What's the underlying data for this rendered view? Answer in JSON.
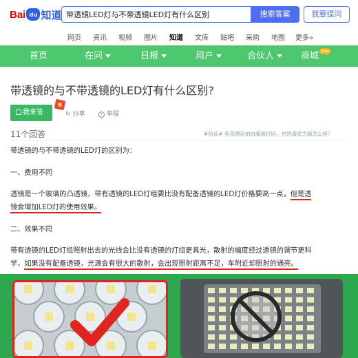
{
  "header": {
    "logo_bai": "Bai",
    "logo_du": "du",
    "logo_zhidao": "知道",
    "search_value": "带透镜LED灯与不带透镜LED灯有什么区别",
    "search_button": "搜索答案",
    "ask_button": "我要提问"
  },
  "channels": [
    "网页",
    "资讯",
    "视频",
    "图片",
    "知道",
    "文库",
    "贴吧",
    "采购",
    "地图",
    "更多»"
  ],
  "active_channel": "知道",
  "green_nav": {
    "items": [
      "首页",
      "在问",
      "日报",
      "用户",
      "合伙人",
      "商城"
    ],
    "new_badge": "New",
    "bg_color": "#4ec86f"
  },
  "question": {
    "title": "带透镜的与不带透镜的LED灯有什么区别?",
    "answer_button": "我来答",
    "share": "分享",
    "report": "举报",
    "answer_count": "11个回答",
    "topic_tag": "#热议#",
    "topic_text": "李现晒自拍给腹肌打码，也的演绎之路怎么样?"
  },
  "answer": {
    "intro": "带透镜的与不带透镜的LED灯的区别为：",
    "h1": "一、费用不同",
    "p1_line1_a": "透镜是一个玻璃的凸透镜，带有透镜的LED灯组要比没有配备透镜的LED灯价格要高一点，",
    "p1_line1_b": "但是透",
    "p1_line2": "镜会增加LED灯的使用效果。",
    "h2": "二、效果不同",
    "p2_line1": "带有透镜的LED灯组照射出去的光线会比没有透镜的灯组更具光，散射的幅度经过透镜的调节更科",
    "p2_line2_a": "学，",
    "p2_line2_b": "如果没有配备透镜，光源会有很大的散射，会出现照射距离不足，车附近却照射的通亮。"
  },
  "images": [
    {
      "icon": "checkmark-icon",
      "color": "#e0241f"
    },
    {
      "icon": "prohibited-icon",
      "color": "#2a2a2a"
    }
  ]
}
